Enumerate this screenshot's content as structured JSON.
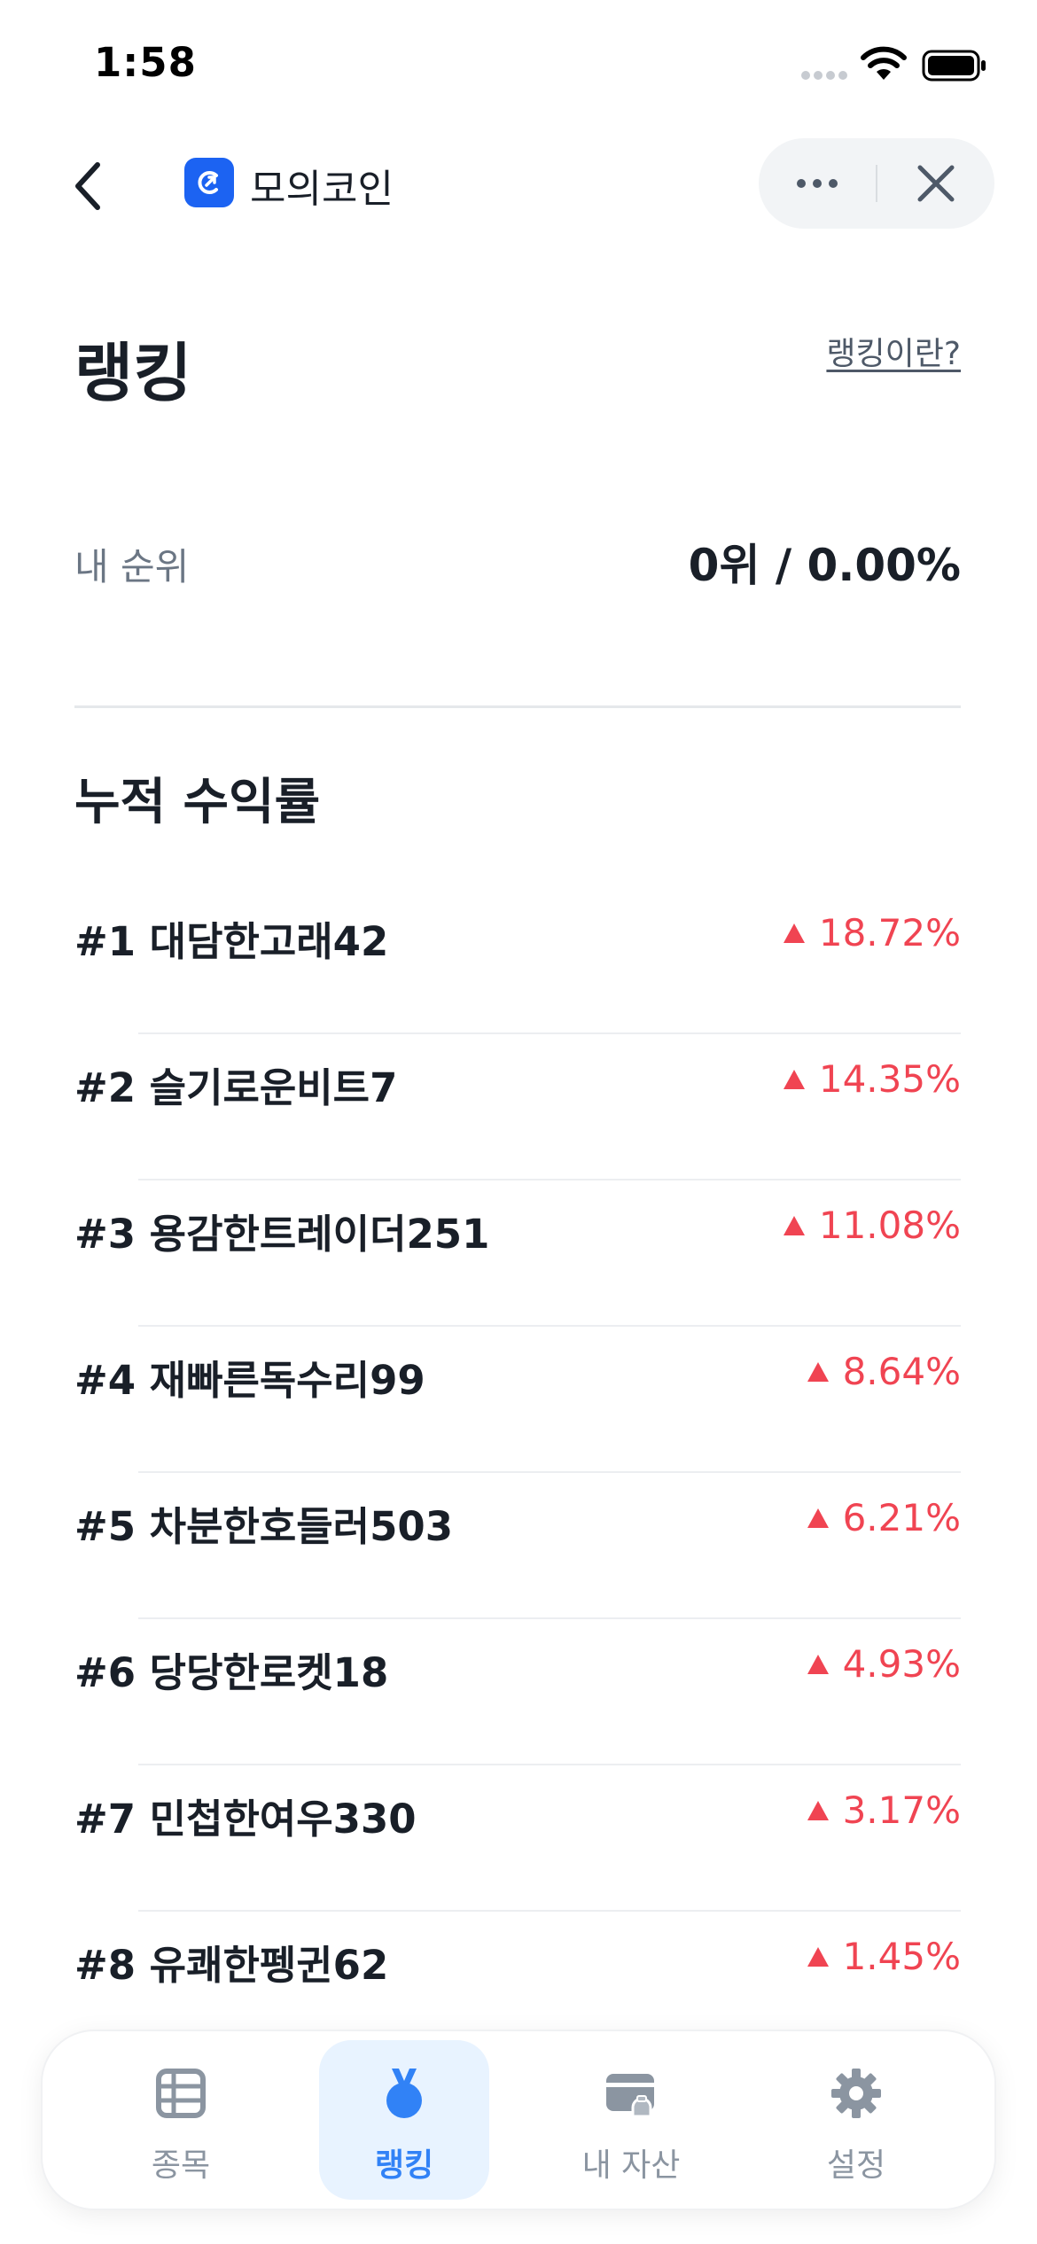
{
  "status_bar": {
    "time": "1:58"
  },
  "nav": {
    "app_title": "모의코인",
    "icons": {
      "back": "chevron-left-icon",
      "app": "coin-app-icon",
      "more": "more-horizontal-icon",
      "close": "close-icon"
    }
  },
  "header": {
    "title": "랭킹",
    "help_link": "랭킹이란?"
  },
  "my_rank": {
    "label": "내 순위",
    "value": "0위 / 0.00%"
  },
  "section": {
    "title": "누적 수익률"
  },
  "rankings": [
    {
      "name": "#1 대담한고래42",
      "change": "18.72%"
    },
    {
      "name": "#2 슬기로운비트7",
      "change": "14.35%"
    },
    {
      "name": "#3 용감한트레이더251",
      "change": "11.08%"
    },
    {
      "name": "#4 재빠른독수리99",
      "change": "8.64%"
    },
    {
      "name": "#5 차분한호들러503",
      "change": "6.21%"
    },
    {
      "name": "#6 당당한로켓18",
      "change": "4.93%"
    },
    {
      "name": "#7 민첩한여우330",
      "change": "3.17%"
    },
    {
      "name": "#8 유쾌한펭귄62",
      "change": "1.45%"
    }
  ],
  "tabs": [
    {
      "label": "종목",
      "icon": "table-icon",
      "active": false
    },
    {
      "label": "랭킹",
      "icon": "medal-icon",
      "active": true
    },
    {
      "label": "내 자산",
      "icon": "wallet-icon",
      "active": false
    },
    {
      "label": "설정",
      "icon": "gear-icon",
      "active": false
    }
  ],
  "colors": {
    "accent": "#3182f6",
    "up": "#f04452",
    "app_icon": "#1c63f2",
    "tab_active_bg": "#e8f3ff"
  }
}
